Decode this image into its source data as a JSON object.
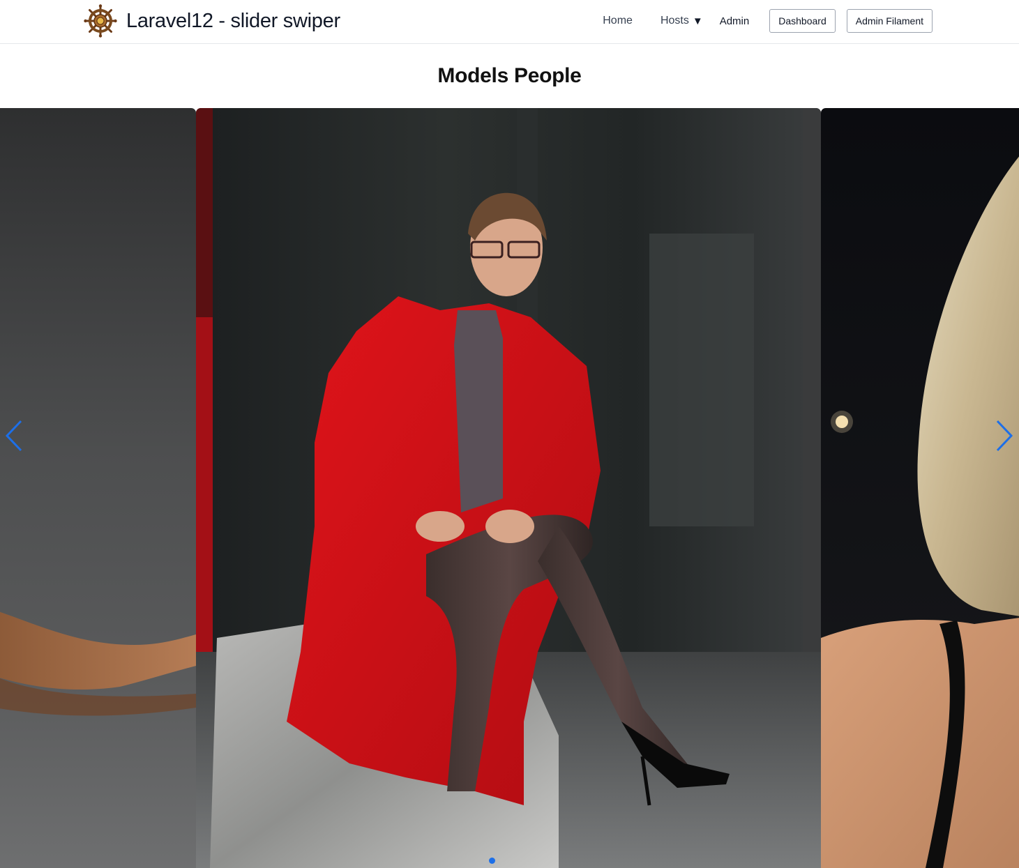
{
  "header": {
    "logo_icon": "ship-wheel-icon",
    "title": "Laravel12 - slider swiper",
    "nav": {
      "home": "Home",
      "hosts": "Hosts",
      "hosts_icon": "caret-down-icon",
      "admin": "Admin",
      "dashboard": "Dashboard",
      "admin_filament": "Admin Filament"
    }
  },
  "page": {
    "title": "Models People"
  },
  "slider": {
    "slides": [
      {
        "label": "model-photo-arm-gray-backdrop",
        "state": "previous"
      },
      {
        "label": "model-photo-red-coat-seated-on-rock",
        "state": "active"
      },
      {
        "label": "model-photo-blonde-hair-night",
        "state": "next"
      }
    ],
    "prev_icon": "chevron-left-icon",
    "next_icon": "chevron-right-icon",
    "pagination_count": 1,
    "active_index": 0,
    "accent_color": "#1d6fe8"
  }
}
